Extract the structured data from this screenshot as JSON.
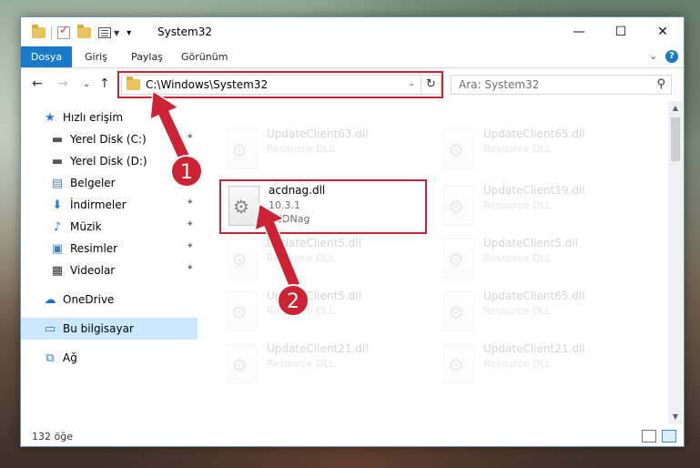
{
  "window": {
    "title": "System32",
    "minimize_glyph": "—",
    "maximize_glyph": "☐",
    "close_glyph": "✕"
  },
  "ribbon": {
    "tabs": [
      {
        "label": "Dosya"
      },
      {
        "label": "Giriş"
      },
      {
        "label": "Paylaş"
      },
      {
        "label": "Görünüm"
      }
    ],
    "expand_glyph": "⌄",
    "help_glyph": "?"
  },
  "nav": {
    "back_glyph": "←",
    "forward_glyph": "→",
    "recent_glyph": "⌄",
    "up_glyph": "↑",
    "address": "C:\\Windows\\System32",
    "address_drop_glyph": "⌄",
    "refresh_glyph": "↻",
    "search_placeholder": "Ara: System32",
    "search_glyph": "⚲"
  },
  "sidebar": {
    "items": [
      {
        "label": "Hızlı erişim",
        "icon": "star-icon",
        "glyph": "★"
      },
      {
        "label": "Yerel Disk (C:)",
        "icon": "drive-icon",
        "glyph": "▬"
      },
      {
        "label": "Yerel Disk (D:)",
        "icon": "drive-icon",
        "glyph": "▬"
      },
      {
        "label": "Belgeler",
        "icon": "documents-icon",
        "glyph": "▤"
      },
      {
        "label": "İndirmeler",
        "icon": "downloads-icon",
        "glyph": "⬇"
      },
      {
        "label": "Müzik",
        "icon": "music-icon",
        "glyph": "♪"
      },
      {
        "label": "Resimler",
        "icon": "pictures-icon",
        "glyph": "▣"
      },
      {
        "label": "Videolar",
        "icon": "videos-icon",
        "glyph": "▦"
      },
      {
        "label": "OneDrive",
        "icon": "cloud-icon",
        "glyph": "☁"
      },
      {
        "label": "Bu bilgisayar",
        "icon": "computer-icon",
        "glyph": "▭"
      },
      {
        "label": "Ağ",
        "icon": "network-icon",
        "glyph": "⧉"
      }
    ],
    "pin_glyph": "✦"
  },
  "files": {
    "bg": [
      {
        "name": "UpdateClient63.dll",
        "type": "Resource DLL"
      },
      {
        "name": "UpdateClient65.dll",
        "type": "Resource DLL"
      },
      {
        "name": "UpdateClient19.dll",
        "type": "Resource DLL"
      },
      {
        "name": "UpdateClient5.dll",
        "type": "Resource DLL"
      },
      {
        "name": "UpdateClient5.dll",
        "type": "Resource DLL"
      },
      {
        "name": "UpdateClient5.dll",
        "type": "Resource DLL"
      },
      {
        "name": "UpdateClient65.dll",
        "type": "Resource DLL"
      },
      {
        "name": "UpdateClient21.dll",
        "type": "Resource DLL"
      },
      {
        "name": "UpdateClient21.dll",
        "type": "Resource DLL"
      }
    ],
    "highlighted": {
      "name": "acdnag.dll",
      "version": "10.3.1",
      "description": "ACDNag"
    }
  },
  "status": {
    "count": "132 öğe"
  },
  "annotations": {
    "badge1": "1",
    "badge2": "2"
  },
  "colors": {
    "accent": "#1979ca",
    "highlight_box": "#cc2233",
    "badge": "#cc2233"
  }
}
